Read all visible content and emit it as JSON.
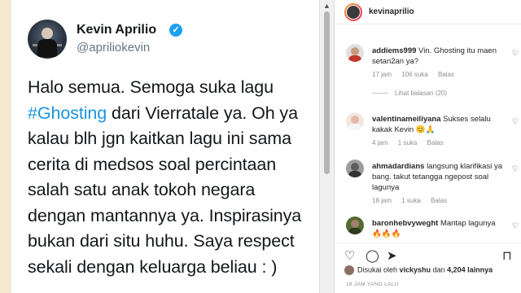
{
  "tweet": {
    "name": "Kevin Aprilio",
    "handle": "@apriliokevin",
    "text_before": "Halo semua. Semoga suka lagu ",
    "hashtag": "#Ghosting",
    "text_after": " dari Vierratale ya. Oh ya kalau blh jgn kaitkan lagu ini sama cerita di medsos soal percintaan salah satu anak tokoh negara dengan mantannya ya. Inspirasinya bukan dari situ huhu. Saya respect sekali dengan keluarga beliau : )",
    "verified_glyph": "✓",
    "menu_glyph": "⌄",
    "colors": {
      "hashtag": "#1b95e0",
      "verified": "#1da1f2"
    }
  },
  "scrollbar": {
    "arrow": "▲"
  },
  "instagram": {
    "username": "kevinaprilio",
    "comments": [
      {
        "user": "addiems999",
        "text": "Vin. Ghosting itu maen setan2an ya?",
        "time": "17 jam",
        "likes": "106 suka",
        "reply": "Balas"
      },
      {
        "user": "valentinameiliyana",
        "text": "Sukses selalu kakak Kevin 😊🙏",
        "time": "4 jam",
        "likes": "1 suka",
        "reply": "Balas"
      },
      {
        "user": "ahmadardians",
        "text": "langsung klarifikasi ya bang. takut tetangga ngepost soal lagunya",
        "time": "18 jam",
        "likes": "1 suka",
        "reply": "Balas"
      },
      {
        "user": "baronhebvyweght",
        "text": "Mantap lagunya 🔥🔥🔥",
        "time": "",
        "likes": "",
        "reply": ""
      }
    ],
    "view_replies": "Lihat balasan (20)",
    "liked_by_prefix": "Disukai oleh ",
    "liked_by_user": "vickyshu",
    "liked_by_mid": " dan ",
    "liked_by_count": "4,204 lainnya",
    "time_ago": "18 JAM YANG LALU",
    "icons": [
      "heart-icon",
      "comment-icon",
      "share-icon",
      "bookmark-icon"
    ]
  }
}
